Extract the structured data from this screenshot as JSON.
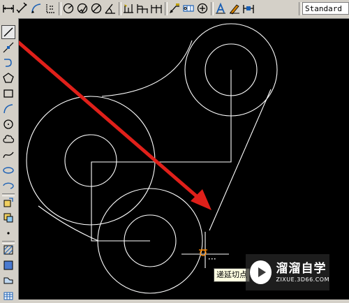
{
  "top_toolbar": {
    "buttons": [
      {
        "name": "dim-linear-icon"
      },
      {
        "name": "dim-aligned-icon"
      },
      {
        "name": "dim-arc-icon"
      },
      {
        "name": "dim-ordinate-icon"
      },
      {
        "name": "dim-radius-icon"
      },
      {
        "name": "dim-jogged-icon"
      },
      {
        "name": "dim-diameter-icon"
      },
      {
        "name": "dim-angular-icon"
      },
      {
        "name": "quick-dim-icon"
      },
      {
        "name": "dim-baseline-icon"
      },
      {
        "name": "dim-continue-icon"
      },
      {
        "name": "quick-leader-icon"
      },
      {
        "name": "tolerance-icon"
      },
      {
        "name": "center-mark-icon"
      },
      {
        "name": "dim-edit-icon"
      },
      {
        "name": "dim-text-edit-icon"
      },
      {
        "name": "dim-update-icon"
      }
    ],
    "dim_style": "Standard"
  },
  "draw_toolbar": {
    "active_tool": "line",
    "tools": [
      {
        "name": "line-icon"
      },
      {
        "name": "construction-line-icon"
      },
      {
        "name": "polyline-icon"
      },
      {
        "name": "polygon-icon"
      },
      {
        "name": "rectangle-icon"
      },
      {
        "name": "arc-icon"
      },
      {
        "name": "circle-icon"
      },
      {
        "name": "revision-cloud-icon"
      },
      {
        "name": "spline-icon"
      },
      {
        "name": "ellipse-icon"
      },
      {
        "name": "ellipse-arc-icon"
      },
      {
        "name": "insert-block-icon"
      },
      {
        "name": "make-block-icon"
      },
      {
        "name": "point-icon"
      },
      {
        "name": "hatch-icon"
      },
      {
        "name": "gradient-icon"
      },
      {
        "name": "region-icon"
      },
      {
        "name": "table-icon"
      }
    ]
  },
  "drawing": {
    "background": "#000000",
    "line_color": "#ffffff",
    "arrow_color": "#e0201a",
    "snap_marker_color": "#ff8a00"
  },
  "tooltip": {
    "text": "递延切点"
  },
  "watermark": {
    "name": "溜溜自学",
    "url": "ZIXUE.3D66.COM"
  }
}
